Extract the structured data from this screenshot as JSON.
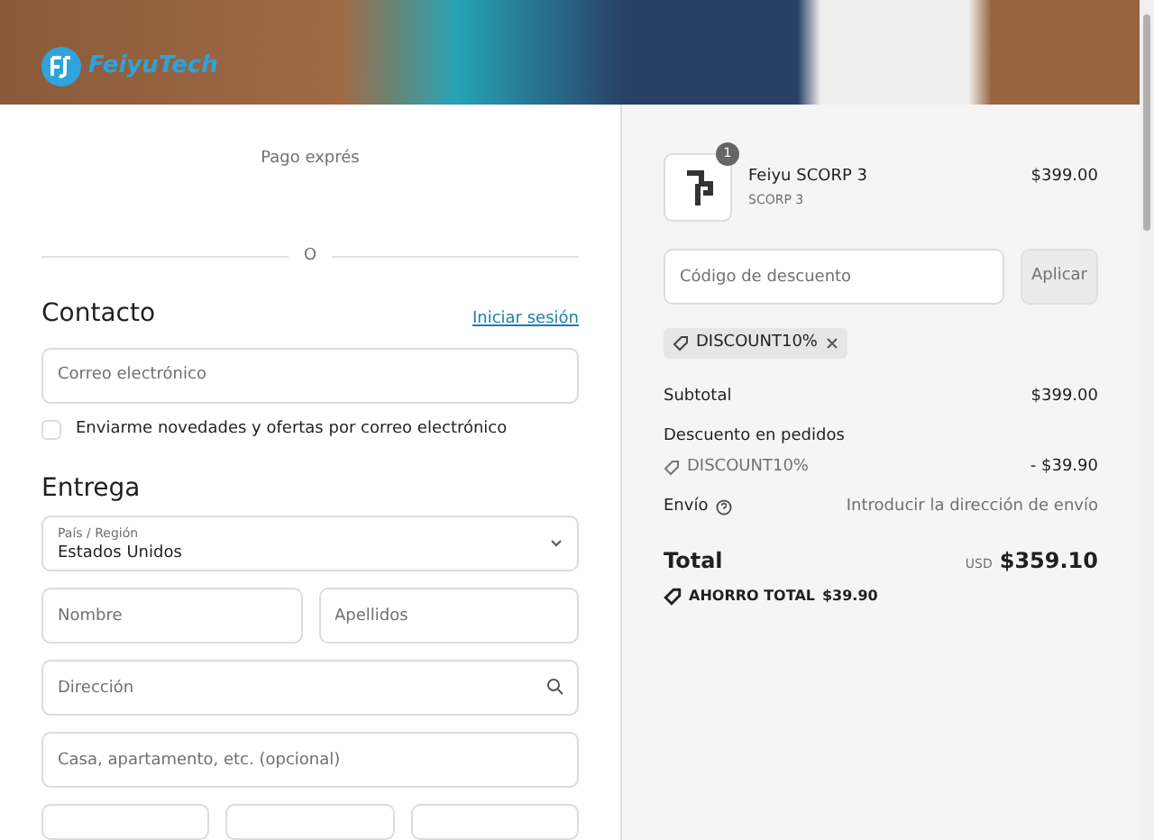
{
  "header": {
    "logo": "FeiyuTech"
  },
  "express": {
    "label": "Pago exprés",
    "divider": "O"
  },
  "contact": {
    "title": "Contacto",
    "login_link": "Iniciar sesión",
    "email": {
      "placeholder": "Correo electrónico"
    },
    "newsletter": {
      "label": "Enviarme novedades y ofertas por correo electrónico",
      "checked": false
    }
  },
  "delivery": {
    "title": "Entrega",
    "country": {
      "label": "País / Región",
      "value": "Estados Unidos"
    },
    "fields": [
      {
        "kind": "pair",
        "items": [
          {
            "placeholder": "Nombre"
          },
          {
            "placeholder": "Apellidos"
          }
        ]
      },
      {
        "kind": "search",
        "items": [
          {
            "placeholder": "Dirección"
          }
        ]
      },
      {
        "kind": "single",
        "items": [
          {
            "placeholder": "Casa, apartamento, etc. (opcional)"
          }
        ]
      }
    ]
  },
  "summary": {
    "product": {
      "name": "Feiyu SCORP 3",
      "variant": "SCORP 3",
      "price": "$399.00",
      "quantity": "1"
    },
    "discount": {
      "placeholder": "Código de descuento",
      "button": "Aplicar",
      "applied_tag": "DISCOUNT10%"
    },
    "lines": [
      {
        "kind": "plain",
        "label": "Subtotal",
        "value": "$399.00"
      },
      {
        "kind": "discount",
        "label": "Descuento en pedidos",
        "code": "DISCOUNT10%",
        "value": "- $39.90"
      },
      {
        "kind": "shipping",
        "label": "Envío",
        "value": "Introducir la dirección de envío"
      }
    ],
    "total": {
      "label": "Total",
      "currency": "USD",
      "value": "$359.10"
    },
    "savings": {
      "label": "AHORRO TOTAL",
      "value": "$39.90"
    }
  }
}
